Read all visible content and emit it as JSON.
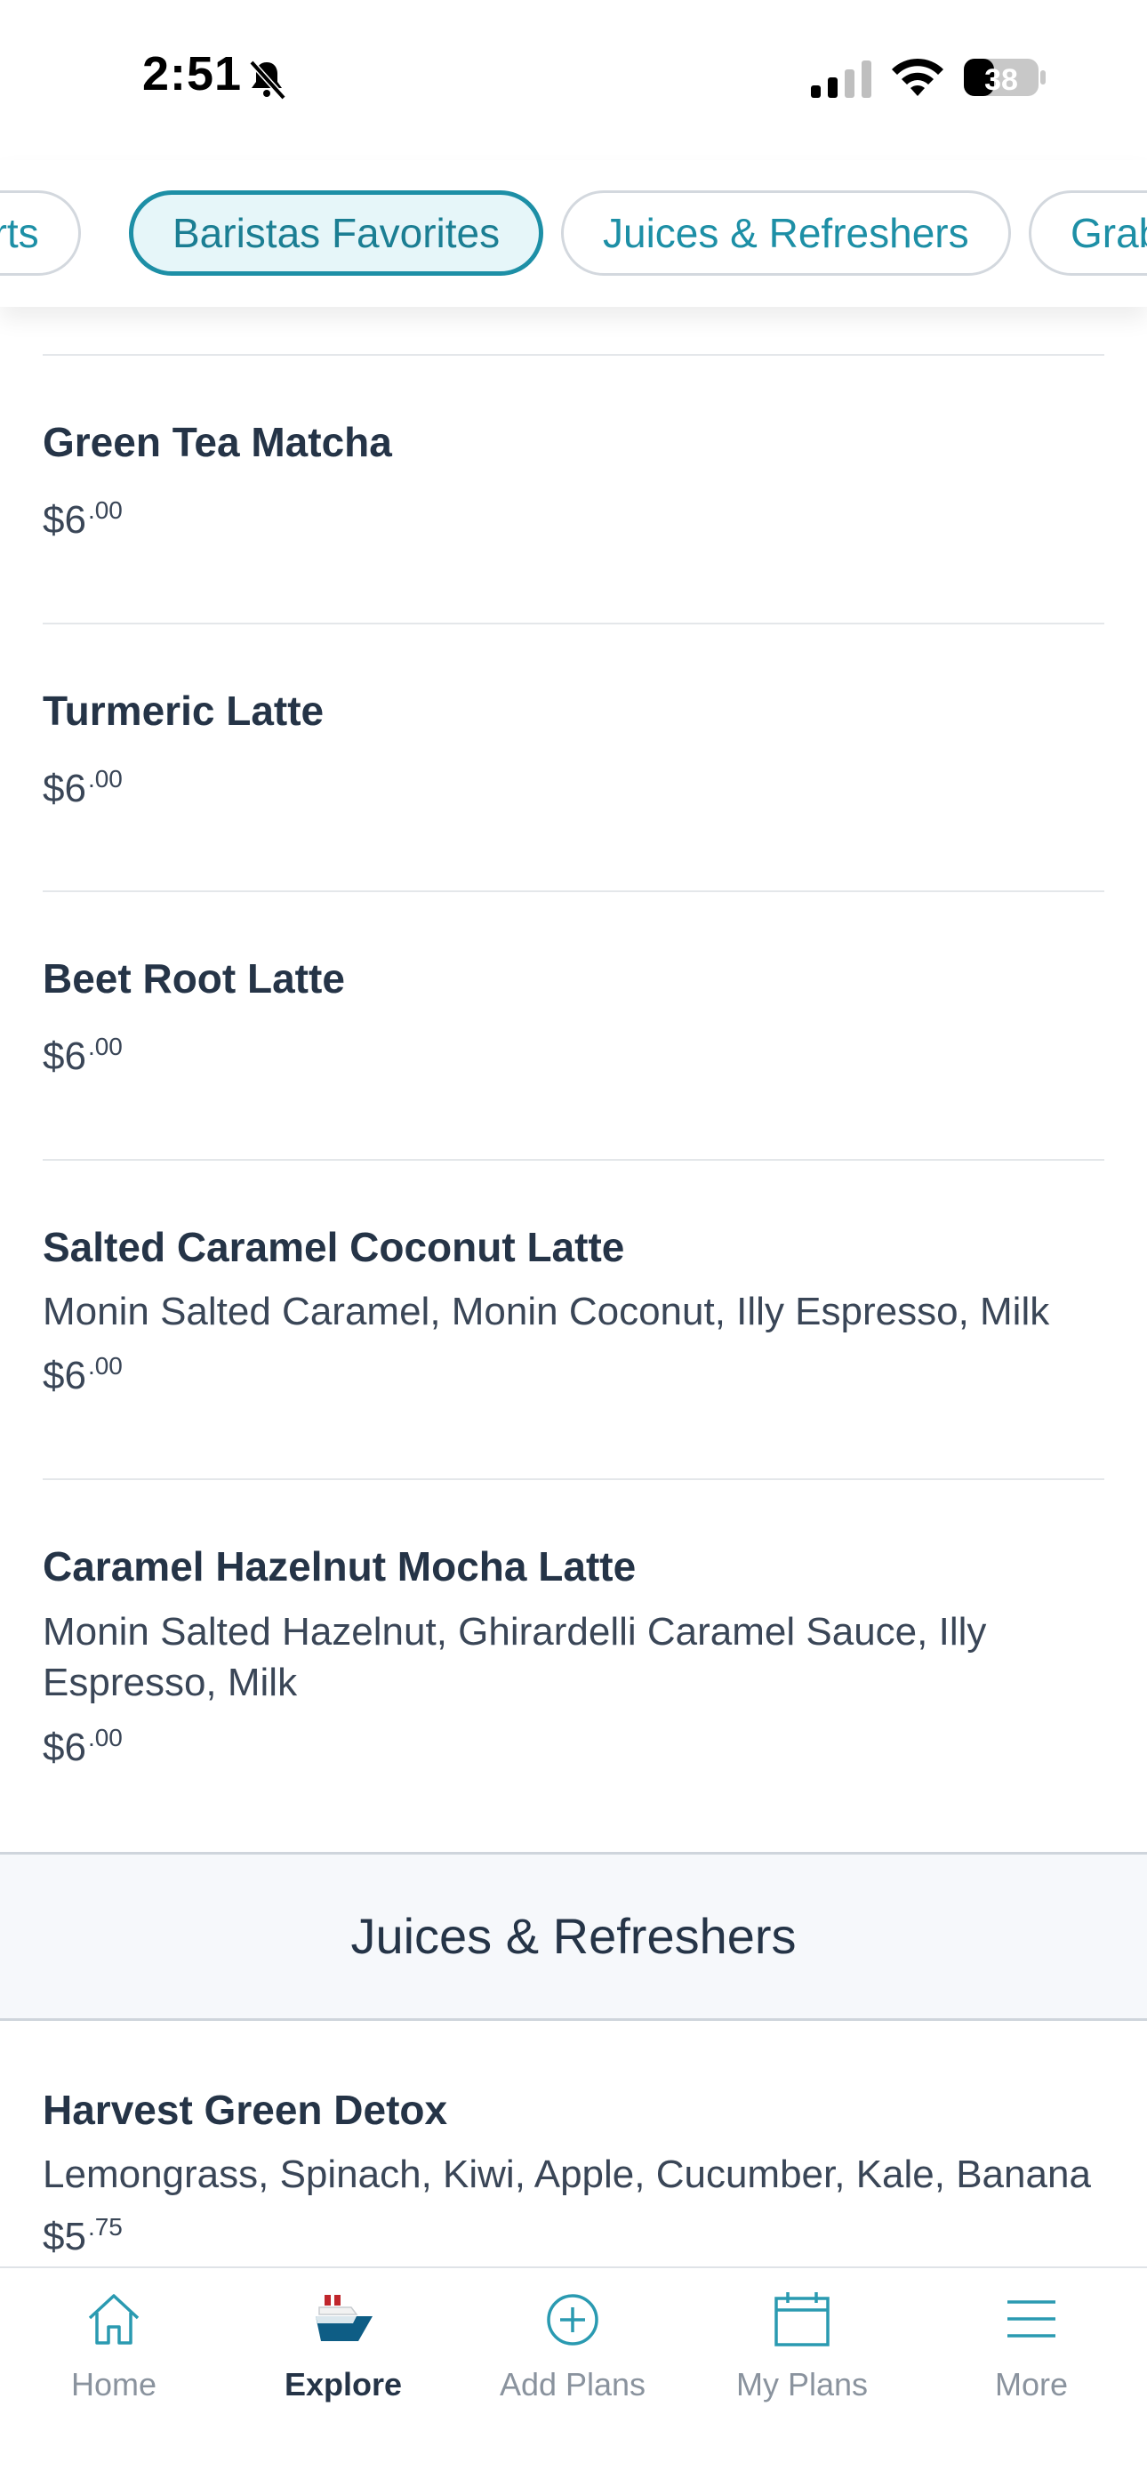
{
  "status_bar": {
    "time": "2:51",
    "battery": "38"
  },
  "categories": [
    {
      "label": "Desserts",
      "visible_text": "erts",
      "active": false
    },
    {
      "label": "Baristas Favorites",
      "active": true
    },
    {
      "label": "Juices & Refreshers",
      "active": false
    },
    {
      "label": "Grab",
      "active": false
    }
  ],
  "items": [
    {
      "name": "Green Tea Matcha",
      "description": "",
      "price_whole": "$6",
      "price_cents": ".00"
    },
    {
      "name": "Turmeric Latte",
      "description": "",
      "price_whole": "$6",
      "price_cents": ".00"
    },
    {
      "name": "Beet Root Latte",
      "description": "",
      "price_whole": "$6",
      "price_cents": ".00"
    },
    {
      "name": "Salted Caramel Coconut Latte",
      "description": "Monin Salted Caramel, Monin Coconut, Illy Espresso, Milk",
      "price_whole": "$6",
      "price_cents": ".00"
    },
    {
      "name": "Caramel Hazelnut Mocha Latte",
      "description": "Monin Salted Hazelnut, Ghirardelli Caramel Sauce, Illy Espresso, Milk",
      "price_whole": "$6",
      "price_cents": ".00"
    }
  ],
  "section": {
    "title": "Juices & Refreshers"
  },
  "section_items": [
    {
      "name": "Harvest Green Detox",
      "description": "Lemongrass, Spinach, Kiwi, Apple, Cucumber, Kale, Banana",
      "price_whole": "$5",
      "price_cents": ".75"
    }
  ],
  "nav": [
    {
      "label": "Home",
      "icon": "home-icon",
      "active": false
    },
    {
      "label": "Explore",
      "icon": "ship-icon",
      "active": true
    },
    {
      "label": "Add Plans",
      "icon": "plus-circle-icon",
      "active": false
    },
    {
      "label": "My Plans",
      "icon": "calendar-icon",
      "active": false
    },
    {
      "label": "More",
      "icon": "menu-icon",
      "active": false
    }
  ],
  "colors": {
    "accent": "#1d8fa6",
    "text": "#253447",
    "muted": "#8a939e",
    "section_bg": "#f6f8fb"
  }
}
